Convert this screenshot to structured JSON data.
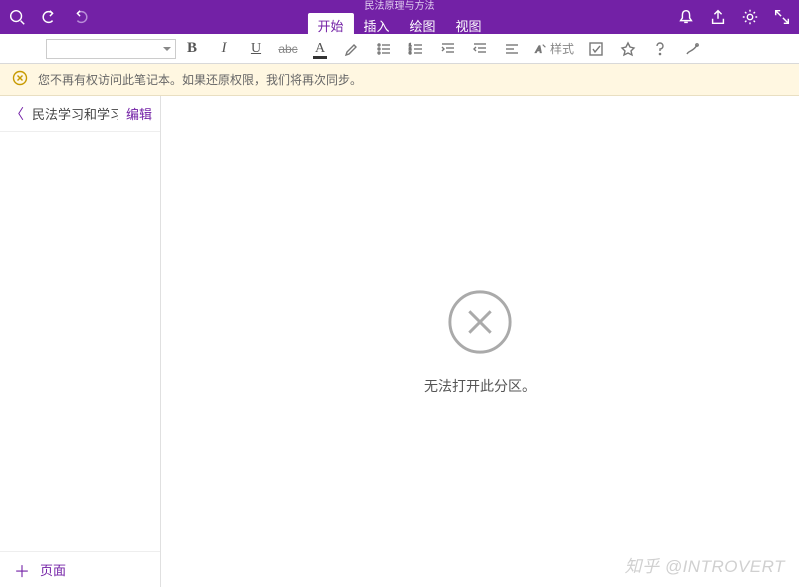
{
  "titlebar": {
    "doc_title": "民法原理与方法",
    "tabs": {
      "start": "开始",
      "insert": "插入",
      "draw": "绘图",
      "view": "视图"
    }
  },
  "ribbon": {
    "font_placeholder": "",
    "bold": "B",
    "italic": "I",
    "underline": "U",
    "strike": "abc",
    "fontcolor": "A",
    "style_label": "样式"
  },
  "warning": {
    "message": "您不再有权访问此笔记本。如果还原权限，我们将再次同步。"
  },
  "sidebar": {
    "section_name": "民法学习和学习民法",
    "edit_label": "编辑",
    "add_page_label": "页面"
  },
  "content": {
    "empty_message": "无法打开此分区。"
  },
  "watermark": "知乎 @INTROVERT"
}
